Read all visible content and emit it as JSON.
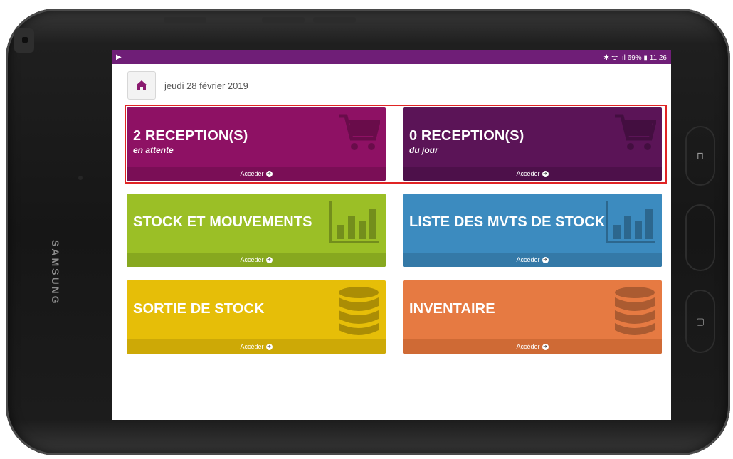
{
  "device": {
    "brand": "SAMSUNG"
  },
  "status_bar": {
    "left_icon": "▶",
    "right_text": "✱ ᯤ .ıl 69% ▮ 11:26"
  },
  "header": {
    "home_icon": "home-icon",
    "date": "jeudi 28 février 2019"
  },
  "tiles": [
    {
      "title": "2 RECEPTION(S)",
      "subtitle": "en attente",
      "action": "Accéder",
      "icon": "cart-icon",
      "color": "#8e1164"
    },
    {
      "title": "0 RECEPTION(S)",
      "subtitle": "du jour",
      "action": "Accéder",
      "icon": "cart-icon",
      "color": "#5b1457"
    },
    {
      "title": "STOCK ET MOUVEMENTS",
      "subtitle": "",
      "action": "Accéder",
      "icon": "bar-chart-icon",
      "color": "#9bbf26"
    },
    {
      "title": "LISTE DES MVTS DE STOCK",
      "subtitle": "",
      "action": "Accéder",
      "icon": "bar-chart-icon",
      "color": "#3c8bbf"
    },
    {
      "title": "SORTIE DE STOCK",
      "subtitle": "",
      "action": "Accéder",
      "icon": "database-icon",
      "color": "#e6be08"
    },
    {
      "title": "INVENTAIRE",
      "subtitle": "",
      "action": "Accéder",
      "icon": "database-icon",
      "color": "#e67a42"
    }
  ],
  "highlight_color": "#e02424"
}
